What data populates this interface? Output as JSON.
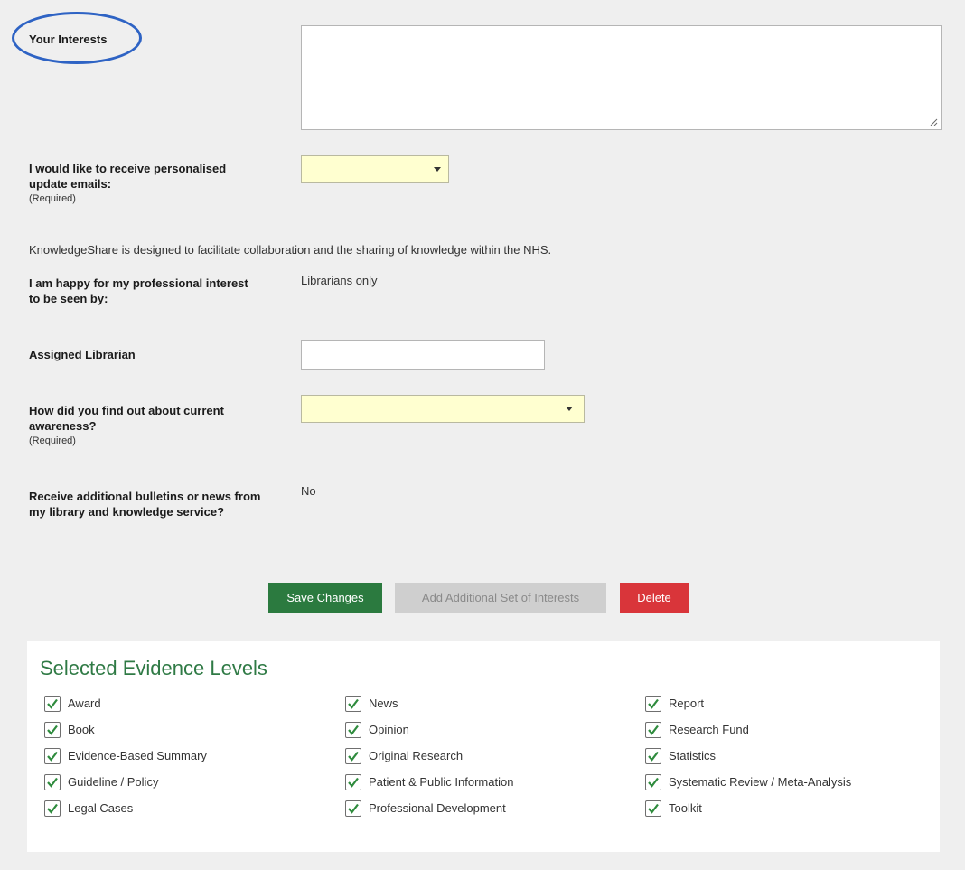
{
  "form": {
    "interests_label": "Your Interests",
    "interests_value": "",
    "emails_label": "I would like to receive personalised update emails:",
    "emails_required": "(Required)",
    "emails_value": "",
    "intro_text": "KnowledgeShare is designed to facilitate collaboration and the sharing of knowledge within the NHS.",
    "visibility_label": "I am happy for my professional interest to be seen by:",
    "visibility_value": "Librarians only",
    "librarian_label": "Assigned Librarian",
    "librarian_value": "",
    "awareness_label": "How did you find out about current awareness?",
    "awareness_required": "(Required)",
    "awareness_value": "",
    "bulletins_label": "Receive additional bulletins or news from my library and knowledge service?",
    "bulletins_value": "No"
  },
  "buttons": {
    "save": "Save Changes",
    "add": "Add Additional Set of Interests",
    "delete": "Delete"
  },
  "colors": {
    "save": "#2b7a3f",
    "add": "#cfcfcf",
    "delete": "#d9353a",
    "accent_green": "#2f7a45",
    "annotation_blue": "#2e63c4"
  },
  "evidence": {
    "title": "Selected Evidence Levels",
    "columns": [
      [
        {
          "label": "Award",
          "checked": true
        },
        {
          "label": "Book",
          "checked": true
        },
        {
          "label": "Evidence-Based Summary",
          "checked": true
        },
        {
          "label": "Guideline / Policy",
          "checked": true
        },
        {
          "label": "Legal Cases",
          "checked": true
        }
      ],
      [
        {
          "label": "News",
          "checked": true
        },
        {
          "label": "Opinion",
          "checked": true
        },
        {
          "label": "Original Research",
          "checked": true
        },
        {
          "label": "Patient & Public Information",
          "checked": true
        },
        {
          "label": "Professional Development",
          "checked": true
        }
      ],
      [
        {
          "label": "Report",
          "checked": true
        },
        {
          "label": "Research Fund",
          "checked": true
        },
        {
          "label": "Statistics",
          "checked": true
        },
        {
          "label": "Systematic Review / Meta-Analysis",
          "checked": true
        },
        {
          "label": "Toolkit",
          "checked": true
        }
      ]
    ]
  }
}
